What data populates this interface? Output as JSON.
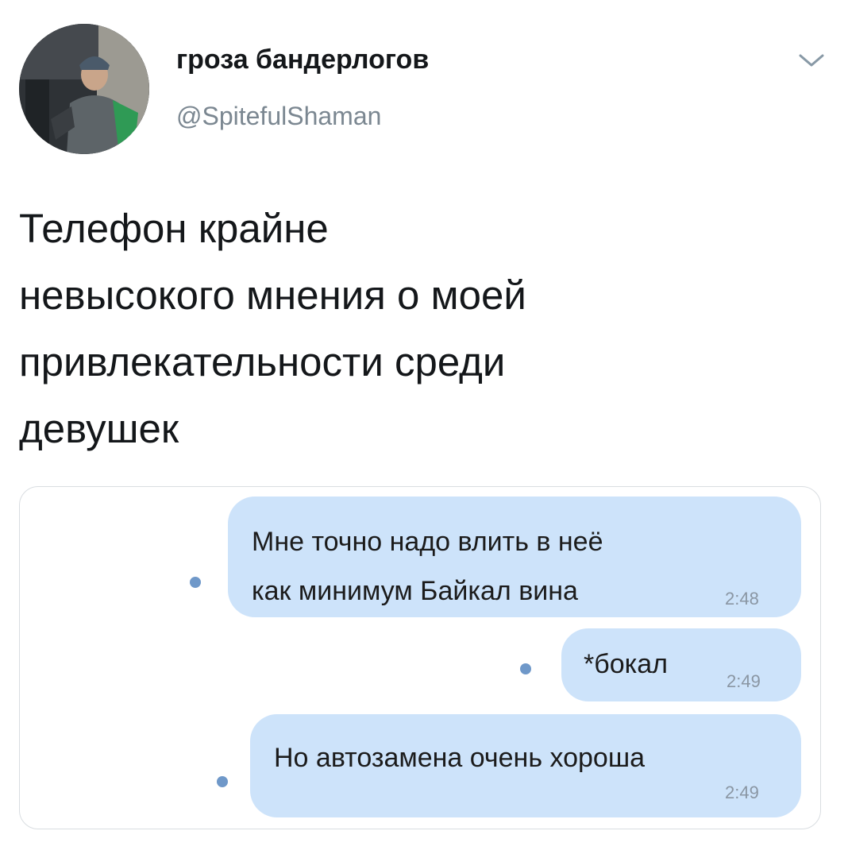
{
  "tweet": {
    "author_name": "гроза бандерлогов",
    "author_handle": "@SpitefulShaman",
    "text_lines": [
      "Телефон крайне",
      "невысокого мнения о моей",
      "привлекательности среди",
      "девушек"
    ]
  },
  "messages": [
    {
      "lines": [
        "Мне точно надо влить в неё",
        "как минимум Байкал вина"
      ],
      "time": "2:48"
    },
    {
      "lines": [
        "*бокал"
      ],
      "time": "2:49"
    },
    {
      "lines": [
        "Но автозамена очень хороша"
      ],
      "time": "2:49"
    }
  ],
  "colors": {
    "bubble": "#cde3fa",
    "unread_dot": "#6f98c9",
    "handle": "#7b8791"
  },
  "icons": {
    "menu": "chevron-down-icon"
  }
}
